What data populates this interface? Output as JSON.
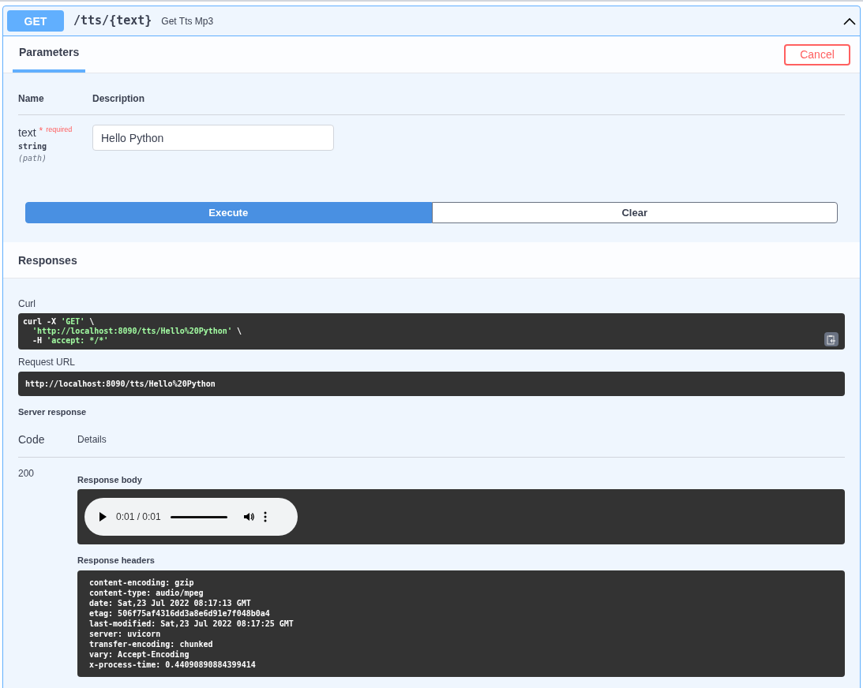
{
  "operation": {
    "method": "GET",
    "path": "/tts/{text}",
    "summary": "Get Tts Mp3",
    "expanded": true
  },
  "tabs": [
    {
      "label": "Parameters",
      "selected": true
    }
  ],
  "cancel_button": "Cancel",
  "parameters": {
    "columns": [
      "Name",
      "Description"
    ],
    "rows": [
      {
        "name": "text",
        "required_mark": "*",
        "required_label": "required",
        "type": "string",
        "location": "(path)",
        "value": "Hello Python"
      }
    ]
  },
  "buttons": [
    {
      "label": "Execute",
      "kind": "primary"
    },
    {
      "label": "Clear",
      "kind": "secondary"
    }
  ],
  "responses_heading": "Responses",
  "curl": {
    "label": "Curl",
    "lines": [
      [
        {
          "kind": "plain",
          "text": "curl -X "
        },
        {
          "kind": "string",
          "text": "'GET'"
        },
        {
          "kind": "plain",
          "text": " \\"
        }
      ],
      [
        {
          "kind": "string",
          "text": "  'http://localhost:8090/tts/Hello%20Python'"
        },
        {
          "kind": "plain",
          "text": " \\"
        }
      ],
      [
        {
          "kind": "plain",
          "text": "  -H "
        },
        {
          "kind": "string",
          "text": "'accept: */*'"
        }
      ]
    ]
  },
  "request_url": {
    "label": "Request URL",
    "value": "http://localhost:8090/tts/Hello%20Python"
  },
  "server_response": {
    "label": "Server response",
    "columns": [
      "Code",
      "Details"
    ],
    "code": "200",
    "body_label": "Response body",
    "audio": {
      "time": "0:01 / 0:01",
      "level": 1
    },
    "headers_label": "Response headers",
    "headers": [
      "content-encoding: gzip",
      "content-type: audio/mpeg",
      "date: Sat,23 Jul 2022 08:17:13 GMT",
      "etag: 506f75af4316dd3a8e6d91e7f048b0a4",
      "last-modified: Sat,23 Jul 2022 08:17:25 GMT",
      "server: uvicorn",
      "transfer-encoding: chunked",
      "vary: Accept-Encoding",
      "x-process-time: 0.44090890884399414"
    ]
  }
}
